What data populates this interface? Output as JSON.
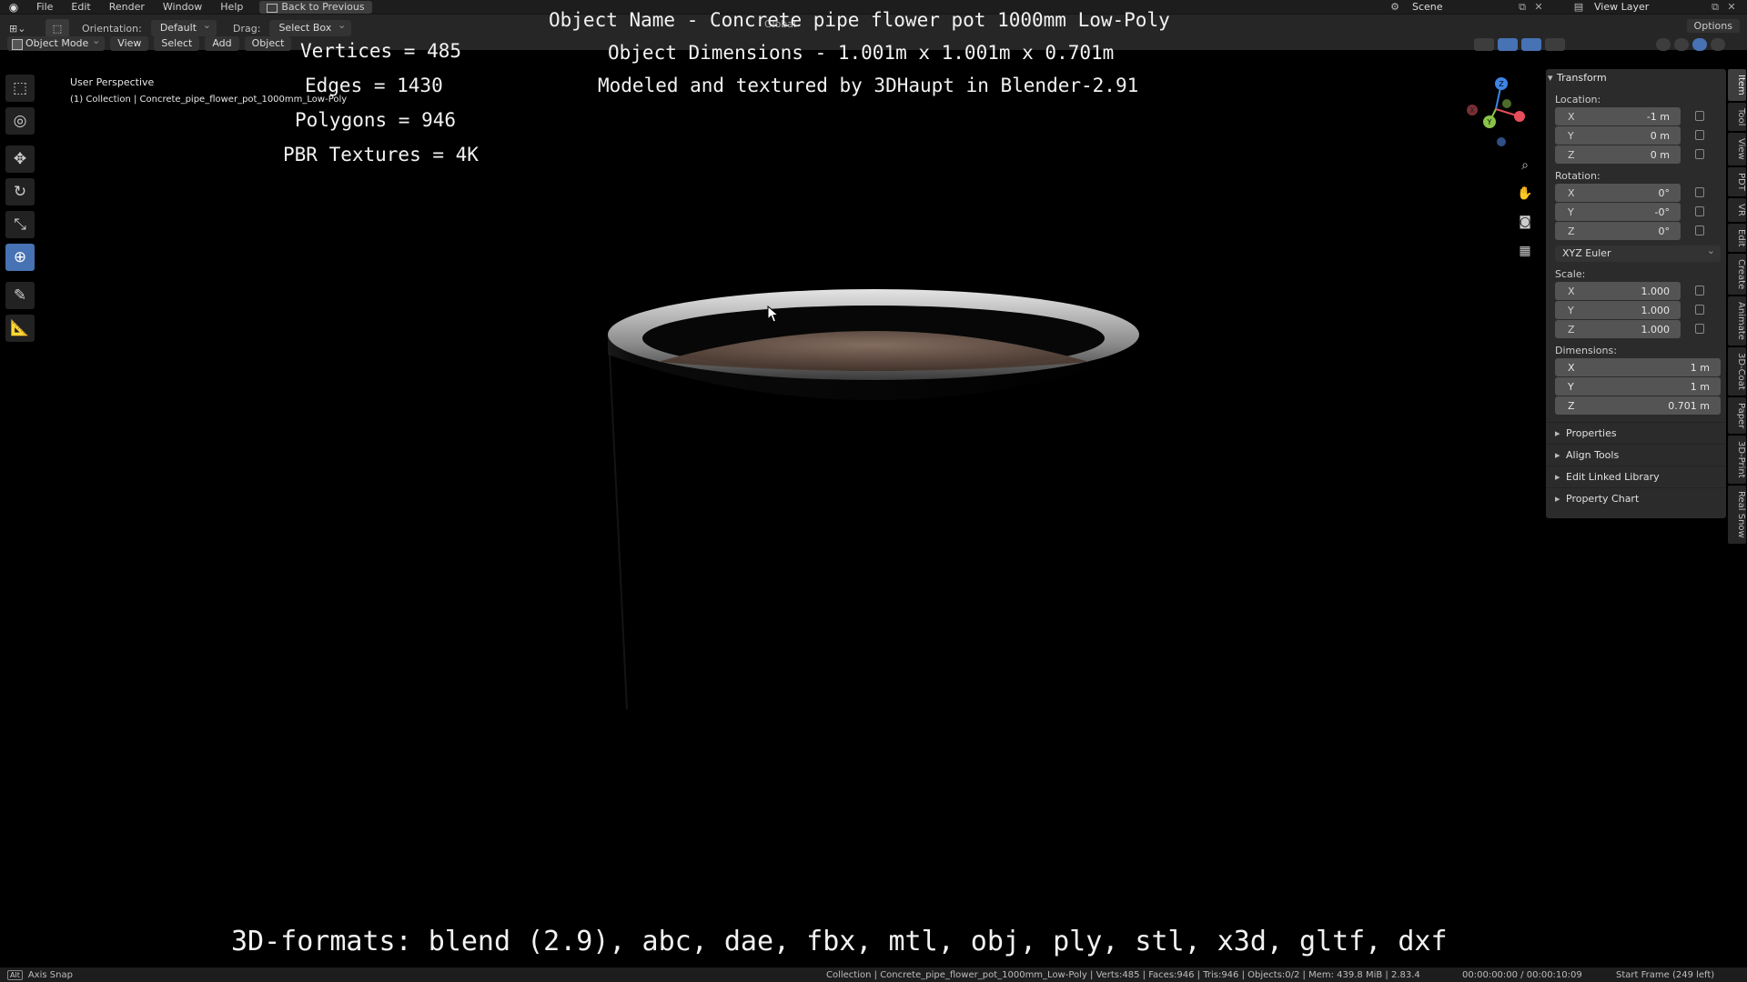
{
  "topbar": {
    "menu": [
      "File",
      "Edit",
      "Render",
      "Window",
      "Help"
    ],
    "back_button": "Back to Previous",
    "scene": "Scene",
    "view_layer": "View Layer"
  },
  "toolbar": {
    "orientation_label": "Orientation:",
    "orientation_value": "Default",
    "drag_label": "Drag:",
    "drag_value": "Select Box",
    "global_label": "Global",
    "options_label": "Options",
    "mode": "Object Mode",
    "menus": [
      "View",
      "Select",
      "Add",
      "Object"
    ]
  },
  "viewport": {
    "perspective": "User Perspective",
    "collection": "(1) Collection | Concrete_pipe_flower_pot_1000mm_Low-Poly",
    "object_name": "Object Name - Concrete pipe flower pot 1000mm Low-Poly",
    "vertices": "Vertices = 485",
    "edges": "Edges = 1430",
    "polygons": "Polygons = 946",
    "textures": "PBR Textures = 4K",
    "dimensions": "Object Dimensions -  1.001m x 1.001m x 0.701m",
    "credit": "Modeled and textured by 3DHaupt in Blender-2.91",
    "formats": "3D-formats: blend (2.9), abc, dae, fbx, mtl, obj, ply, stl, x3d, gltf, dxf"
  },
  "tools": [
    "select-box",
    "cursor",
    "move",
    "rotate",
    "scale",
    "transform",
    "annotate",
    "measure"
  ],
  "gizmo": {
    "x_color": "#e84d5c",
    "y_color": "#8bc34a",
    "z_color": "#3d85e6",
    "x_label": "X",
    "y_label": "Y",
    "z_label": "Z"
  },
  "npanel": {
    "header": "Transform",
    "location_label": "Location:",
    "location": [
      {
        "axis": "X",
        "value": "-1 m"
      },
      {
        "axis": "Y",
        "value": "0 m"
      },
      {
        "axis": "Z",
        "value": "0 m"
      }
    ],
    "rotation_label": "Rotation:",
    "rotation": [
      {
        "axis": "X",
        "value": "0°"
      },
      {
        "axis": "Y",
        "value": "-0°"
      },
      {
        "axis": "Z",
        "value": "0°"
      }
    ],
    "rotation_mode": "XYZ Euler",
    "scale_label": "Scale:",
    "scale": [
      {
        "axis": "X",
        "value": "1.000"
      },
      {
        "axis": "Y",
        "value": "1.000"
      },
      {
        "axis": "Z",
        "value": "1.000"
      }
    ],
    "dimensions_label": "Dimensions:",
    "dimensions": [
      {
        "axis": "X",
        "value": "1 m"
      },
      {
        "axis": "Y",
        "value": "1 m"
      },
      {
        "axis": "Z",
        "value": "0.701 m"
      }
    ],
    "collapsed": [
      "Properties",
      "Align Tools",
      "Edit Linked Library",
      "Property Chart"
    ]
  },
  "sidetabs": [
    "Item",
    "Tool",
    "View",
    "PDT",
    "VR",
    "Edit",
    "Create",
    "Animate",
    "3D-Coat",
    "Paper",
    "3D-Print",
    "Real Snow"
  ],
  "statusbar": {
    "key": "Alt",
    "left": "Axis Snap",
    "stats": "Collection | Concrete_pipe_flower_pot_1000mm_Low-Poly | Verts:485 | Faces:946 | Tris:946 | Objects:0/2 | Mem: 439.8 MiB | 2.83.4",
    "time": "00:00:00:00 / 00:00:10:09",
    "frame": "Start Frame (249 left)"
  }
}
